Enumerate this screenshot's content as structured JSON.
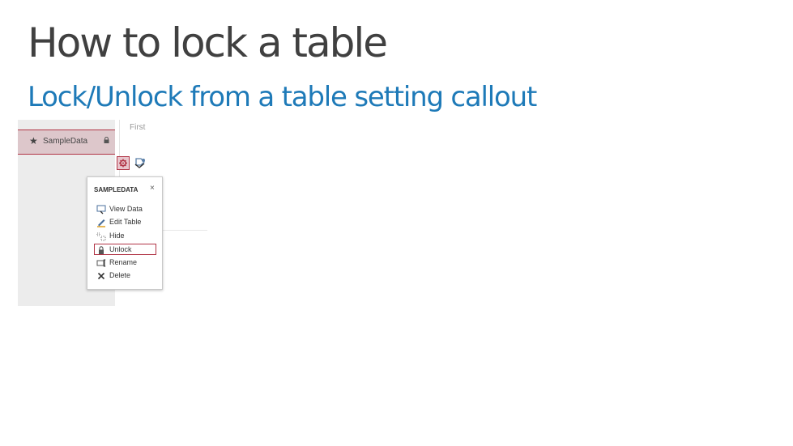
{
  "slide": {
    "title": "How to lock a table",
    "subtitle": "Lock/Unlock from a table setting callout"
  },
  "navpane": {
    "selected_table": "SampleData",
    "star_icon": "star-icon",
    "lock_icon": "lock-icon"
  },
  "view": {
    "column_label": "First"
  },
  "callout": {
    "header": "SAMPLEDATA",
    "close_symbol": "×",
    "items": [
      {
        "label": "View Data",
        "icon": "view-data-icon"
      },
      {
        "label": "Edit Table",
        "icon": "edit-table-icon"
      },
      {
        "label": "Hide",
        "icon": "hide-icon"
      },
      {
        "label": "Unlock",
        "icon": "unlock-icon",
        "highlighted": true
      },
      {
        "label": "Rename",
        "icon": "rename-icon"
      },
      {
        "label": "Delete",
        "icon": "delete-icon"
      }
    ]
  },
  "colors": {
    "accent": "#b13546",
    "subtitle": "#1e7ab8",
    "title": "#404040"
  }
}
